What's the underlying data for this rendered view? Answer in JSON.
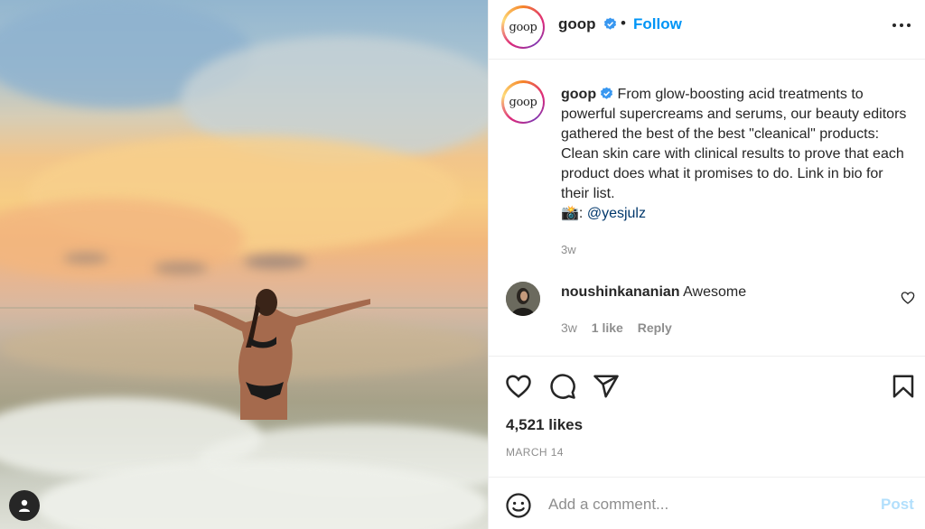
{
  "post": {
    "photo_icon": "user-tag-icon"
  },
  "header": {
    "username": "goop",
    "logo_text": "goop",
    "separator": "•",
    "follow_label": "Follow",
    "more_icon": "more-options-icon",
    "verified_icon": "verified-badge-icon"
  },
  "caption": {
    "username": "goop",
    "text": "From glow-boosting acid treatments to powerful supercreams and serums, our beauty editors gathered the best of the best \"cleanical\" products: Clean skin care with clinical results to prove that each product does what it promises to do. Link in bio for their list.",
    "credit_emoji": "📸:",
    "mention": "@yesjulz",
    "time": "3w"
  },
  "comment": {
    "username": "noushinkananian",
    "text": "Awesome",
    "time": "3w",
    "likes": "1 like",
    "reply_label": "Reply"
  },
  "actions": {
    "likes": "4,521 likes",
    "date": "MARCH 14",
    "icons": [
      "heart-icon",
      "comment-icon",
      "share-icon",
      "bookmark-icon"
    ]
  },
  "add_comment": {
    "placeholder": "Add a comment...",
    "post_label": "Post",
    "emoji_icon": "emoji-icon"
  },
  "colors": {
    "link": "#0095f6",
    "mention": "#00376b",
    "muted": "#8e8e8e",
    "post_disabled": "#b2dffc"
  }
}
